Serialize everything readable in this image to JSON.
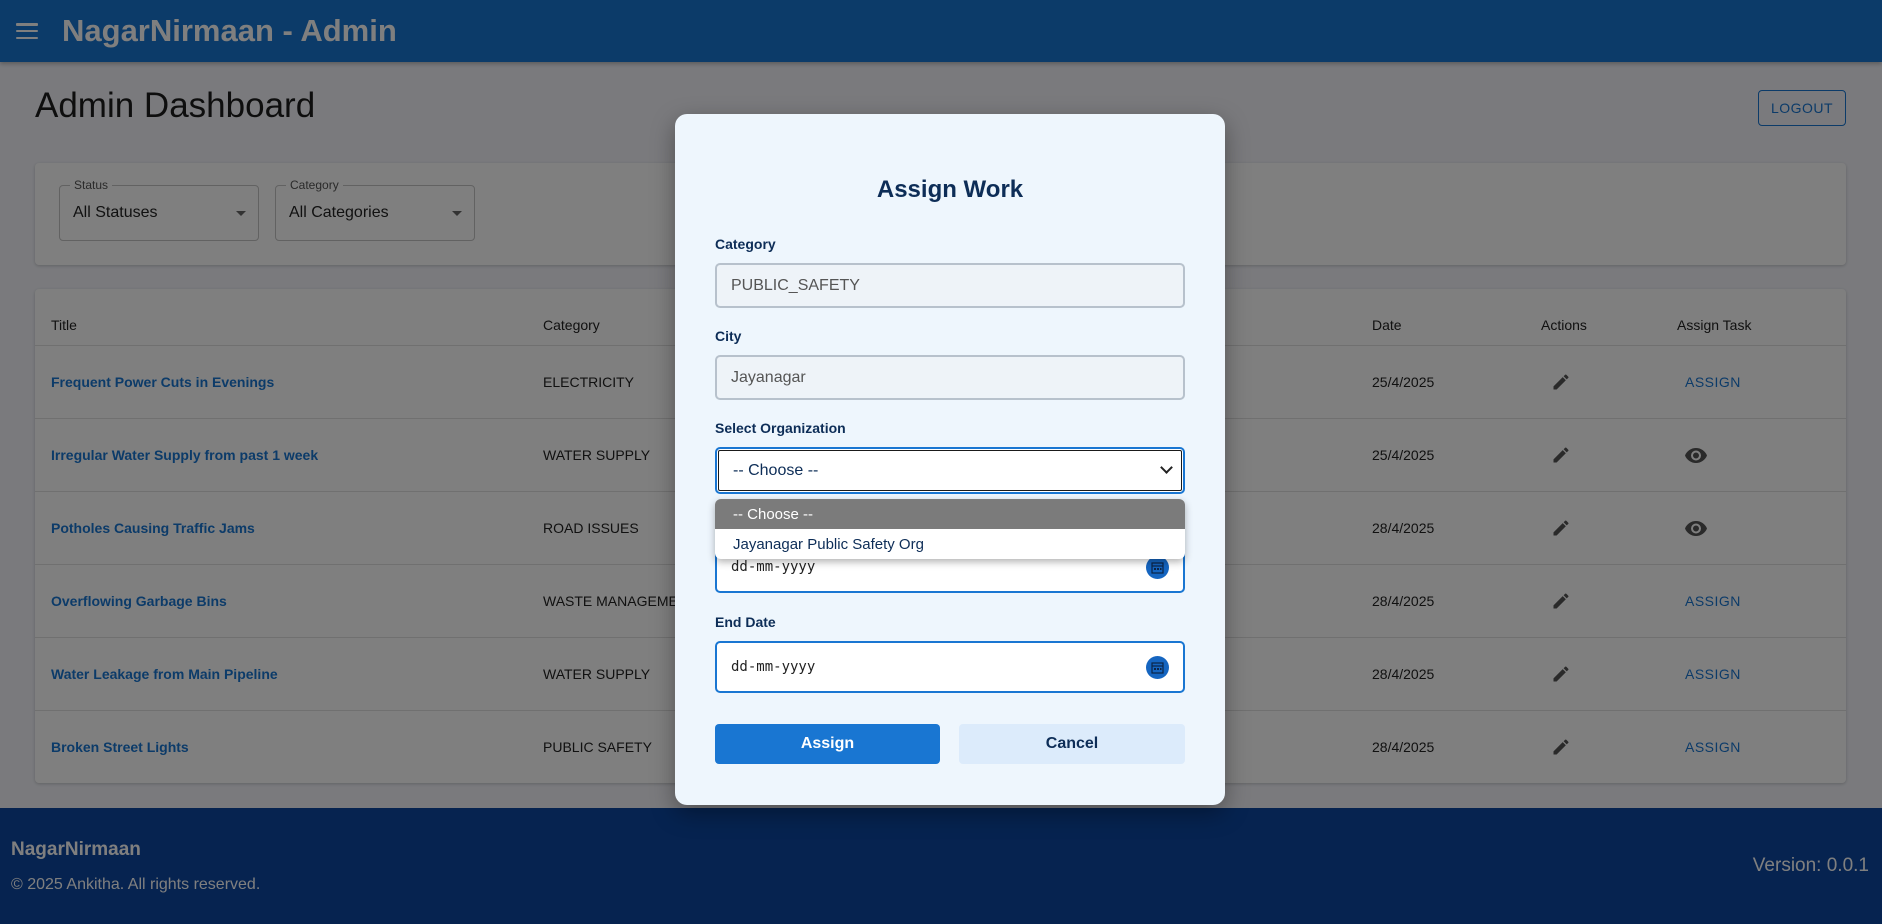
{
  "app": {
    "title": "NagarNirmaan - Admin"
  },
  "page": {
    "title": "Admin Dashboard",
    "logout_label": "LOGOUT"
  },
  "filters": [
    {
      "label": "Status",
      "value": "All Statuses"
    },
    {
      "label": "Category",
      "value": "All Categories"
    }
  ],
  "table": {
    "headers": {
      "title": "Title",
      "category": "Category",
      "date": "Date",
      "actions": "Actions",
      "assign": "Assign Task"
    },
    "rows": [
      {
        "title": "Frequent Power Cuts in Evenings",
        "category": "ELECTRICITY",
        "date": "25/4/2025",
        "assign": "ASSIGN",
        "assign_mode": "link"
      },
      {
        "title": "Irregular Water Supply from past 1 week",
        "category": "WATER SUPPLY",
        "date": "25/4/2025",
        "assign": "",
        "assign_mode": "eye-icon"
      },
      {
        "title": "Potholes Causing Traffic Jams",
        "category": "ROAD ISSUES",
        "date": "28/4/2025",
        "assign": "",
        "assign_mode": "eye-icon"
      },
      {
        "title": "Overflowing Garbage Bins",
        "category": "WASTE MANAGEMENT",
        "date": "28/4/2025",
        "assign": "ASSIGN",
        "assign_mode": "link"
      },
      {
        "title": "Water Leakage from Main Pipeline",
        "category": "WATER SUPPLY",
        "date": "28/4/2025",
        "assign": "ASSIGN",
        "assign_mode": "link"
      },
      {
        "title": "Broken Street Lights",
        "category": "PUBLIC SAFETY",
        "date": "28/4/2025",
        "assign": "ASSIGN",
        "assign_mode": "link"
      }
    ]
  },
  "footer": {
    "brand": "NagarNirmaan",
    "copyright": "© 2025 Ankitha. All rights reserved.",
    "version": "Version: 0.0.1"
  },
  "modal": {
    "title": "Assign Work",
    "category_label": "Category",
    "category_value": "PUBLIC_SAFETY",
    "city_label": "City",
    "city_value": "Jayanagar",
    "org_label": "Select Organization",
    "org_value": "-- Choose --",
    "org_options": [
      "-- Choose --",
      "Jayanagar Public Safety Org"
    ],
    "end_date_label": "End Date",
    "date_placeholder": "dd-mm-yyyy",
    "assign_label": "Assign",
    "cancel_label": "Cancel"
  },
  "icons": {
    "menu": "menu-icon",
    "edit": "pencil-icon",
    "view": "eye-icon",
    "calendar": "calendar-icon",
    "chevron": "chevron-down-icon"
  },
  "colors": {
    "primary": "#1976d2",
    "footer": "#0d47a1",
    "modal_bg": "#eef6fd",
    "overlay": "rgba(0,0,0,0.5)"
  }
}
